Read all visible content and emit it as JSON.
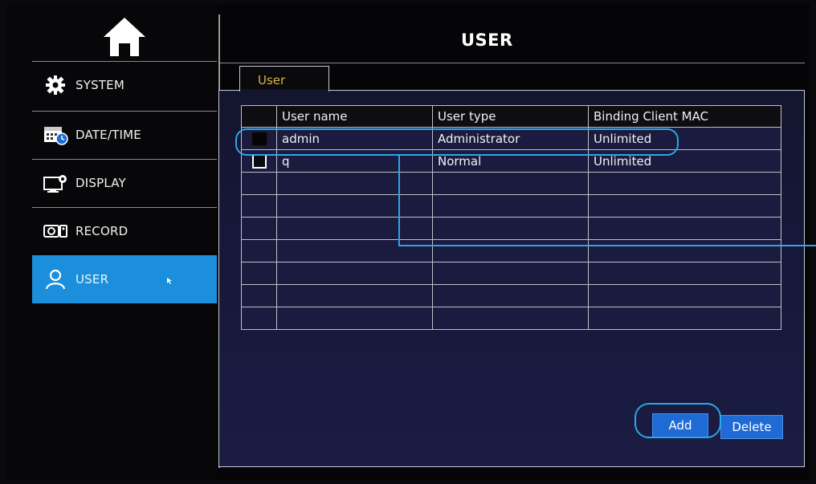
{
  "header": {
    "title": "USER"
  },
  "sidebar": {
    "items": [
      {
        "label": "SYSTEM",
        "icon": "gear-icon"
      },
      {
        "label": "DATE/TIME",
        "icon": "calendar-icon"
      },
      {
        "label": "DISPLAY",
        "icon": "display-icon"
      },
      {
        "label": "RECORD",
        "icon": "record-icon"
      },
      {
        "label": "USER",
        "icon": "user-icon",
        "active": true
      }
    ]
  },
  "tab": {
    "label": "User"
  },
  "table": {
    "columns": [
      "User name",
      "User type",
      "Binding Client MAC"
    ],
    "rows": [
      {
        "name": "admin",
        "type": "Administrator",
        "mac": "Unlimited"
      },
      {
        "name": "q",
        "type": "Normal",
        "mac": "Unlimited"
      }
    ]
  },
  "buttons": {
    "add": "Add",
    "delete": "Delete"
  },
  "colors": {
    "accent": "#1b8fdb",
    "tab_text": "#d9b44a",
    "button": "#1e6bd6",
    "highlight": "#2aa8e8"
  }
}
